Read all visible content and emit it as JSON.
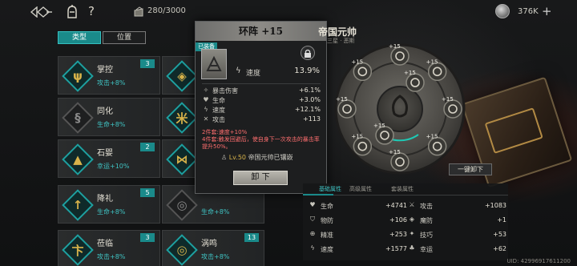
{
  "topbar": {
    "capacity": "280/3000",
    "currency": "376K",
    "plus_label": "+",
    "help_label": "?"
  },
  "filters": {
    "type_label": "类型",
    "position_label": "位置"
  },
  "sets": [
    {
      "name": "掌控",
      "bonus": "攻击+8%",
      "count": "3",
      "glyph": "ψ",
      "active": true
    },
    {
      "name": "同化",
      "bonus": "生命+8%",
      "count": "",
      "glyph": "§",
      "active": false
    },
    {
      "name": "石婴",
      "bonus": "幸运+10%",
      "count": "2",
      "glyph": "▲",
      "active": true
    },
    {
      "name": "降礼",
      "bonus": "生命+8%",
      "count": "5",
      "glyph": "↑",
      "active": true
    },
    {
      "name": "莅临",
      "bonus": "攻击+8%",
      "count": "3",
      "glyph": "卞",
      "active": true
    }
  ],
  "sets_right": [
    {
      "name": "",
      "bonus": "",
      "count": "",
      "glyph": "◈",
      "active": true
    },
    {
      "name": "",
      "bonus": "",
      "count": "",
      "glyph": "米",
      "active": true
    },
    {
      "name": "",
      "bonus": "",
      "count": "",
      "glyph": "⋈",
      "active": true
    },
    {
      "name": "",
      "bonus": "生命+8%",
      "count": "",
      "glyph": "◎",
      "active": false
    },
    {
      "name": "涡鸣",
      "bonus": "攻击+8%",
      "count": "13",
      "glyph": "◎",
      "active": true
    }
  ],
  "rune_panel": {
    "title": "环阵 +15",
    "equipped_tag": "已装备",
    "main_stat_label": "速度",
    "main_stat_value": "13.9%",
    "substats": [
      {
        "icon": "crit-damage-icon",
        "label": "暴击伤害",
        "value": "+6.1%"
      },
      {
        "icon": "heart-icon",
        "label": "生命",
        "value": "+3.0%"
      },
      {
        "icon": "speed-icon",
        "label": "速度",
        "value": "+12.1%"
      },
      {
        "icon": "attack-icon",
        "label": "攻击",
        "value": "+113"
      }
    ],
    "set_desc_1": "2件套:速度+10%",
    "set_desc_2": "4件套:触发回避后，使自身下一次攻击的暴击率提升50%。",
    "owner_level": "Lv.50",
    "owner_text": "帝国元帅已镶嵌",
    "unequip_label": "卸 下"
  },
  "character": {
    "name": "帝国元帅",
    "sub": "三星 · 恶斯"
  },
  "wheel": {
    "slot_labels": [
      "+15",
      "+15",
      "+15",
      "+15",
      "+15",
      "+15",
      "+15",
      "+15",
      "+15",
      "+15"
    ],
    "accent": "#1ec8b4"
  },
  "unequip_all_label": "一键卸下",
  "stats_panel": {
    "tabs": [
      "基础属性",
      "高级属性",
      "套装属性"
    ],
    "rows": [
      {
        "icon": "heart-icon",
        "label": "生命",
        "value": "+4741"
      },
      {
        "icon": "sword-icon",
        "label": "攻击",
        "value": "+1083"
      },
      {
        "icon": "shield-icon",
        "label": "物防",
        "value": "+106"
      },
      {
        "icon": "magic-shield-icon",
        "label": "魔防",
        "value": "+1"
      },
      {
        "icon": "crosshair-icon",
        "label": "精准",
        "value": "+253"
      },
      {
        "icon": "skill-icon",
        "label": "技巧",
        "value": "+53"
      },
      {
        "icon": "speed-icon",
        "label": "速度",
        "value": "+1577"
      },
      {
        "icon": "clover-icon",
        "label": "幸运",
        "value": "+62"
      }
    ]
  },
  "uid": "UID: 42996917611200"
}
